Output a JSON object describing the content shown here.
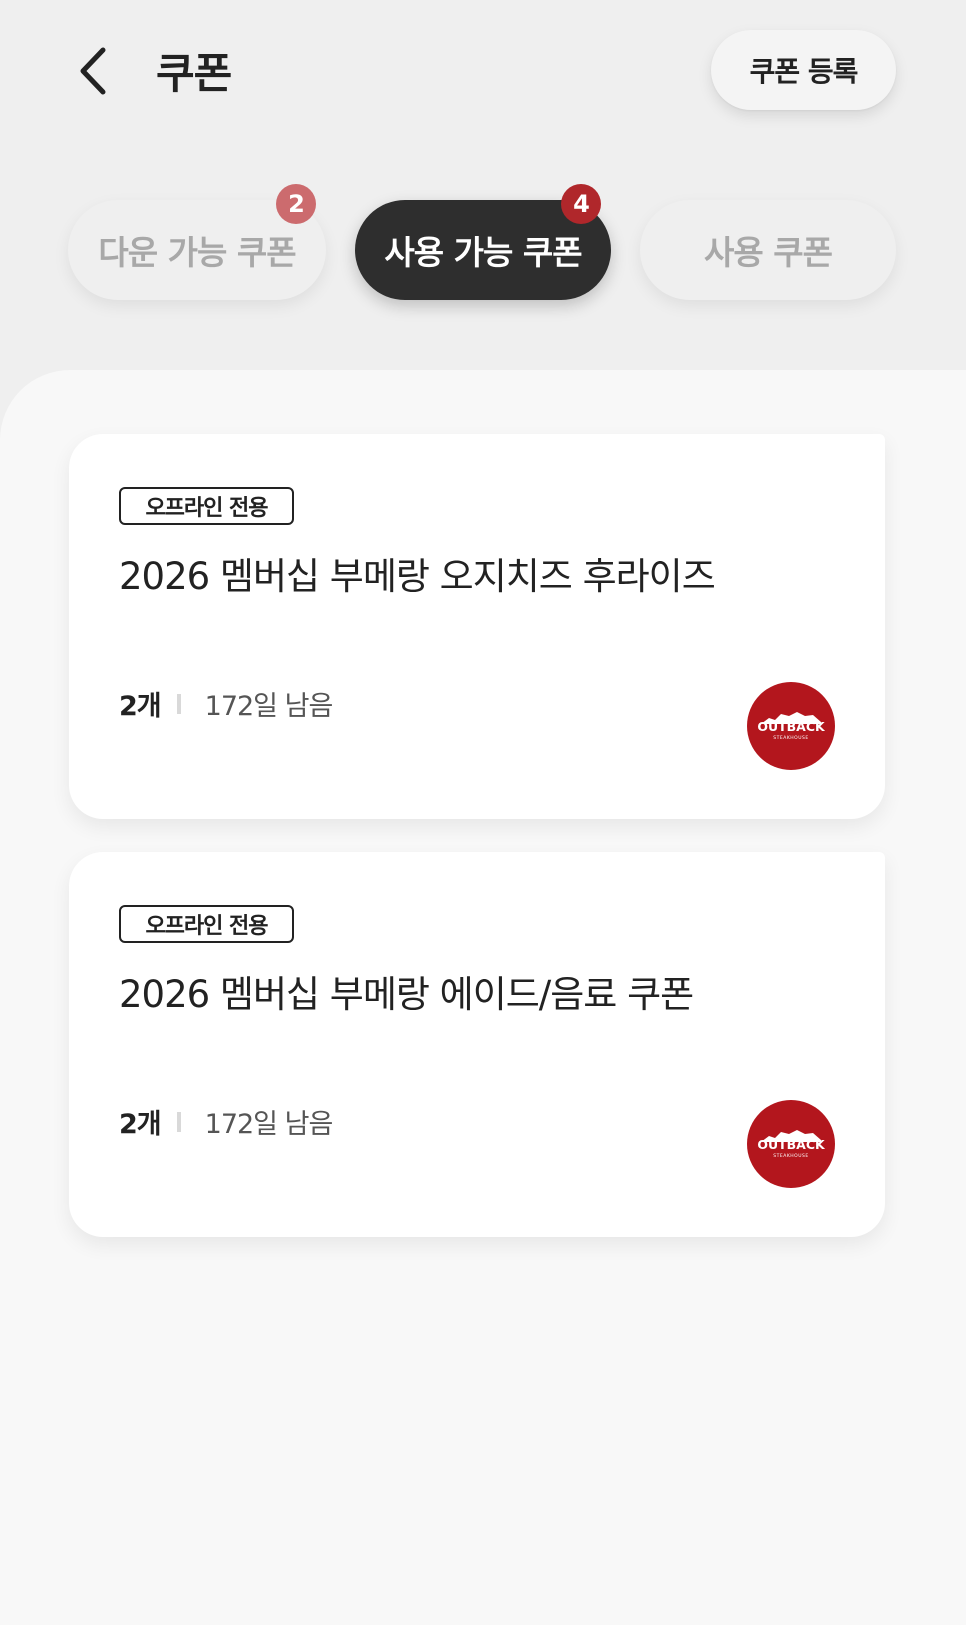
{
  "header": {
    "back_icon": "chevron-left-icon",
    "title": "쿠폰",
    "register_label": "쿠폰 등록"
  },
  "tabs": [
    {
      "label": "다운 가능 쿠폰",
      "badge": "2",
      "active": false
    },
    {
      "label": "사용 가능 쿠폰",
      "badge": "4",
      "active": true
    },
    {
      "label": "사용 쿠폰",
      "badge": "",
      "active": false
    }
  ],
  "coupons": [
    {
      "chip": "오프라인 전용",
      "title": "2026 멤버십 부메랑 오지치즈 후라이즈",
      "quantity": "2개",
      "remaining": "172일 남음",
      "brand_logo": {
        "name": "OUTBACK",
        "sub": "STEAKHOUSE"
      }
    },
    {
      "chip": "오프라인 전용",
      "title": "2026 멤버십 부메랑 에이드/음료 쿠폰",
      "quantity": "2개",
      "remaining": "172일 남음",
      "brand_logo": {
        "name": "OUTBACK",
        "sub": "STEAKHOUSE"
      }
    }
  ],
  "colors": {
    "background": "#efefef",
    "active_tab": "#2e2e2e",
    "badge_light": "#cc6b6e",
    "badge_dark": "#b0272b",
    "brand_red": "#b3161d"
  }
}
